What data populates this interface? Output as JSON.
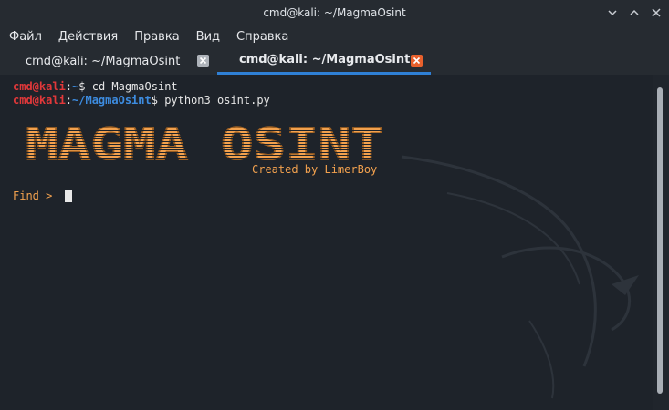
{
  "window": {
    "title": "cmd@kali: ~/MagmaOsint"
  },
  "menu": {
    "items": [
      "Файл",
      "Действия",
      "Правка",
      "Вид",
      "Справка"
    ]
  },
  "tabs": [
    {
      "label": "cmd@kali: ~/MagmaOsint",
      "active": false
    },
    {
      "label": "cmd@kali: ~/MagmaOsint",
      "active": true
    }
  ],
  "terminal": {
    "line1": {
      "user": "cmd@kali",
      "sep": ":",
      "path": "~",
      "prompt": "$ ",
      "command": "cd MagmaOsint"
    },
    "line2": {
      "user": "cmd@kali",
      "sep": ":",
      "path": "~/MagmaOsint",
      "prompt": "$ ",
      "command": "python3 osint.py"
    },
    "banner_text": "MAGMA OSINT",
    "credit": "Created by LimerBoy",
    "find_prompt": "Find > "
  },
  "colors": {
    "accent": "#2f80d6",
    "user": "#e2383a",
    "path": "#3d8ce0",
    "banner": "#f2a14e",
    "tab_close_active": "#e8602c"
  },
  "icons": {
    "minimize": "chevron-down-icon",
    "maximize": "chevron-up-icon",
    "close": "close-icon",
    "tab_close": "close-icon"
  }
}
